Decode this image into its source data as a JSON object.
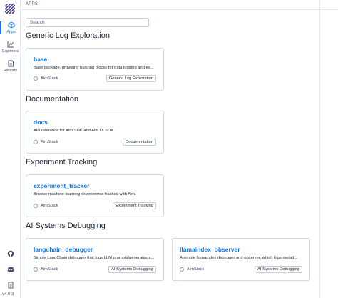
{
  "sidebar": {
    "items": [
      {
        "label": "Apps",
        "icon": "apps-icon"
      },
      {
        "label": "Explorers",
        "icon": "explorers-icon"
      },
      {
        "label": "Reports",
        "icon": "reports-icon"
      }
    ],
    "version": "v4.0.3"
  },
  "header": {
    "title": "APPS"
  },
  "search": {
    "placeholder": "Search",
    "value": ""
  },
  "sections": [
    {
      "title": "Generic Log Exploration",
      "cards": [
        {
          "name": "base",
          "description": "Base package, providing building blocks for data logging and ex...",
          "author": "AimStack",
          "tag": "Generic Log Exploration"
        }
      ]
    },
    {
      "title": "Documentation",
      "cards": [
        {
          "name": "docs",
          "description": "API reference for Aim SDK and Aim UI SDK.",
          "author": "AimStack",
          "tag": "Documentation"
        }
      ]
    },
    {
      "title": "Experiment Tracking",
      "cards": [
        {
          "name": "experiment_tracker",
          "description": "Browse machine learning experiments tracked with Aim.",
          "author": "AimStack",
          "tag": "Experiment Tracking"
        }
      ]
    },
    {
      "title": "AI Systems Debugging",
      "cards": [
        {
          "name": "langchain_debugger",
          "description": "Simple LangChain debugger that logs LLM prompts/generations...",
          "author": "AimStack",
          "tag": "AI Systems Debugging"
        },
        {
          "name": "llamaindex_observer",
          "description": "A simple llamaindex debugger and observer, which logs metad...",
          "author": "AimStack",
          "tag": "AI Systems Debugging"
        }
      ]
    }
  ],
  "colors": {
    "accent": "#1473e6",
    "text": "#1c2331",
    "border": "#d3d7df"
  }
}
